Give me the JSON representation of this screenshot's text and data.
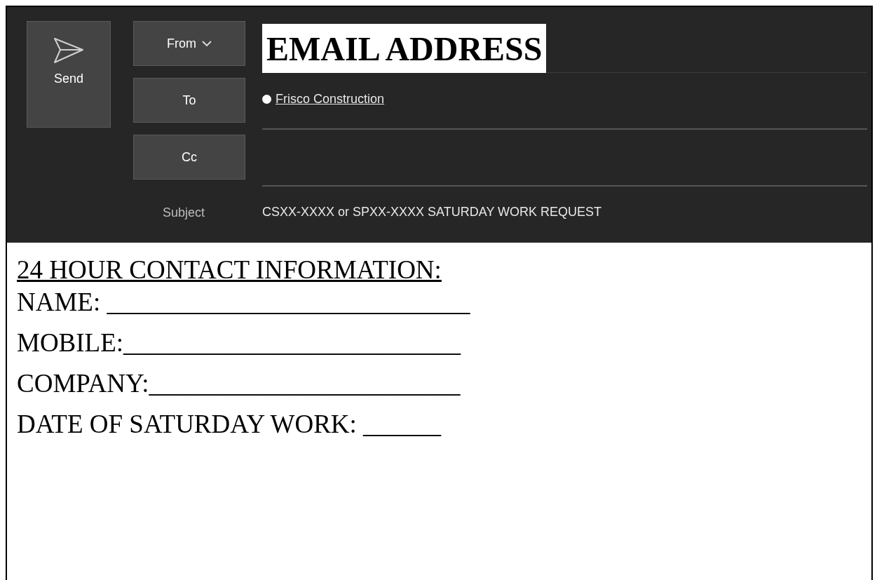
{
  "send_button": {
    "label": "Send"
  },
  "fields": [
    {
      "kind": "button",
      "label": "From",
      "dropdown": true
    },
    {
      "kind": "button",
      "label": "To",
      "dropdown": false
    },
    {
      "kind": "button",
      "label": "Cc",
      "dropdown": false
    }
  ],
  "from_value": "EMAIL ADDRESS",
  "to_recipients": [
    {
      "name": "Frisco Construction"
    }
  ],
  "subject": {
    "label": "Subject",
    "value": "CSXX-XXXX or SPXX-XXXX SATURDAY WORK REQUEST"
  },
  "body": [
    {
      "kind": "heading",
      "text": "24 HOUR CONTACT INFORMATION:"
    },
    {
      "kind": "line",
      "text": "NAME: ____________________________"
    },
    {
      "kind": "line",
      "text": "MOBILE:__________________________"
    },
    {
      "kind": "line",
      "text": "COMPANY:________________________"
    },
    {
      "kind": "line",
      "text": "DATE OF SATURDAY WORK: ______"
    }
  ]
}
